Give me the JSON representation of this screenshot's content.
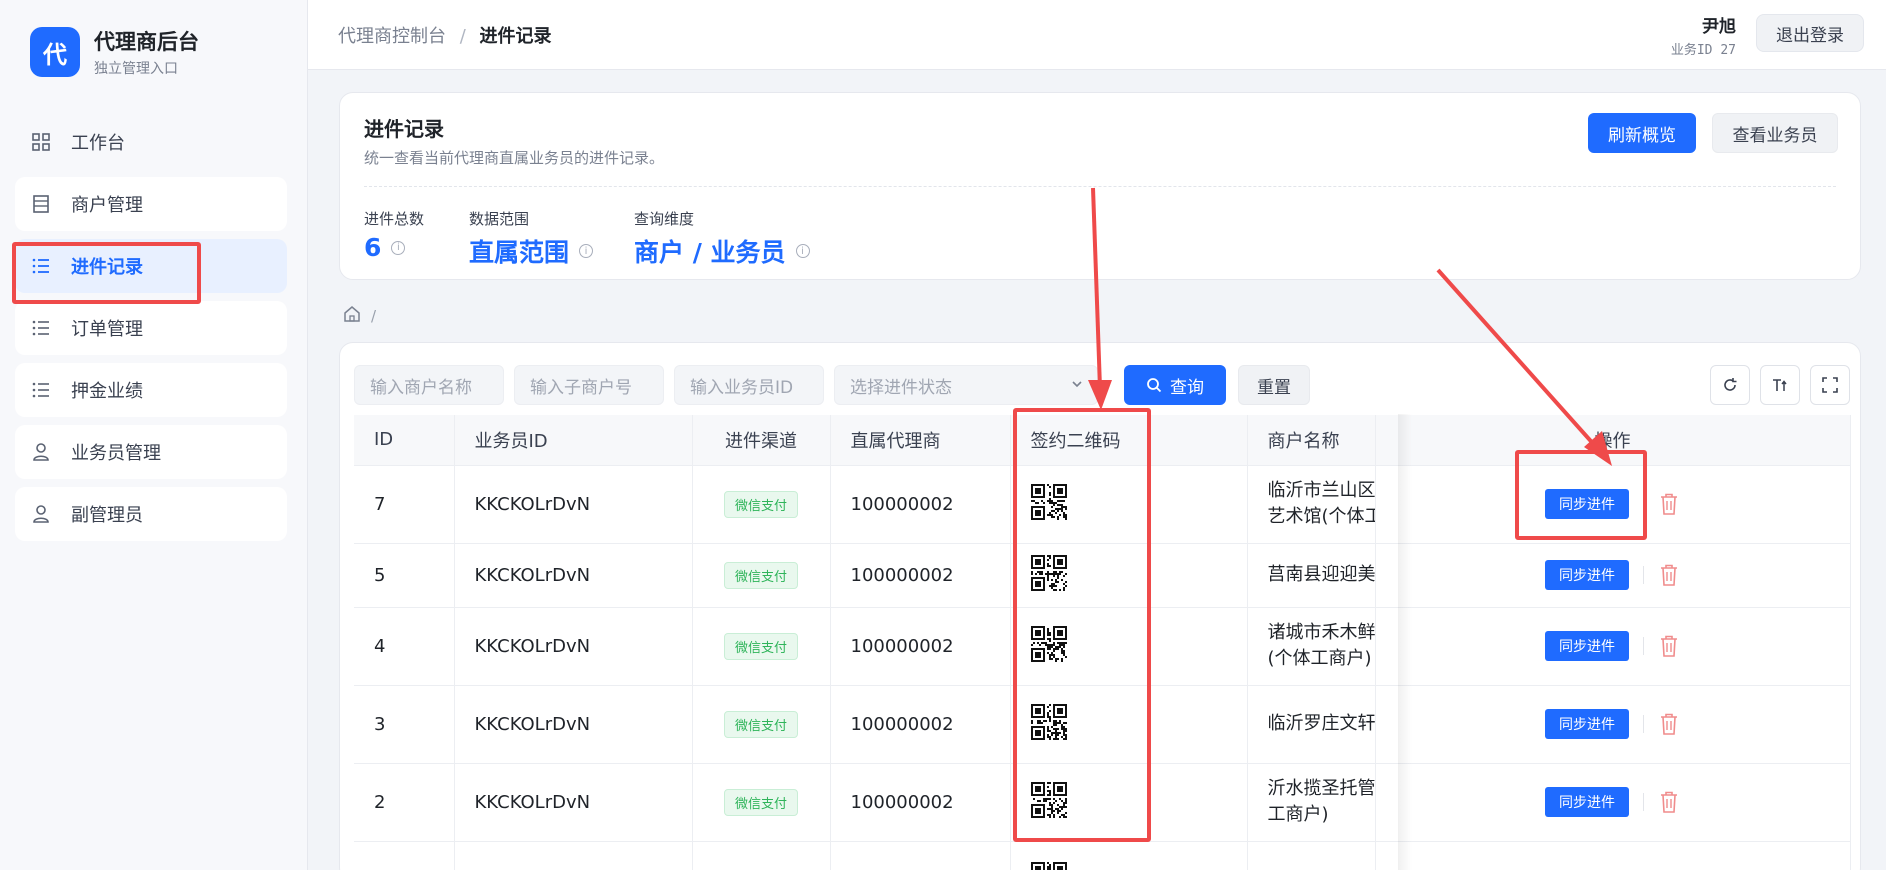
{
  "brand": {
    "logo_char": "代",
    "title": "代理商后台",
    "subtitle": "独立管理入口"
  },
  "menu": [
    {
      "label": "工作台",
      "icon": "grid-icon"
    },
    {
      "label": "商户管理",
      "icon": "store-icon"
    },
    {
      "label": "进件记录",
      "icon": "list-icon",
      "active": true
    },
    {
      "label": "订单管理",
      "icon": "list-icon"
    },
    {
      "label": "押金业绩",
      "icon": "list-icon"
    },
    {
      "label": "业务员管理",
      "icon": "user-icon"
    },
    {
      "label": "副管理员",
      "icon": "user-icon"
    }
  ],
  "topbar": {
    "breadcrumb_parent": "代理商控制台",
    "breadcrumb_sep": "/",
    "breadcrumb_current": "进件记录",
    "user_name": "尹旭",
    "user_id": "业务ID 27",
    "logout_label": "退出登录"
  },
  "header": {
    "title": "进件记录",
    "desc": "统一查看当前代理商直属业务员的进件记录。",
    "refresh_label": "刷新概览",
    "view_staff_label": "查看业务员",
    "stats": [
      {
        "label": "进件总数",
        "value": "6"
      },
      {
        "label": "数据范围",
        "value": "直属范围"
      },
      {
        "label": "查询维度",
        "value": "商户 / 业务员"
      }
    ]
  },
  "sub_breadcrumb": {
    "sep": "/"
  },
  "filters": {
    "merchant_name_placeholder": "输入商户名称",
    "sub_merchant_placeholder": "输入子商户号",
    "staff_id_placeholder": "输入业务员ID",
    "status_placeholder": "选择进件状态",
    "query_label": "查询",
    "reset_label": "重置"
  },
  "table": {
    "headers": [
      "ID",
      "业务员ID",
      "进件渠道",
      "直属代理商",
      "签约二维码",
      "商户名称",
      "操作"
    ],
    "rows": [
      {
        "id": "7",
        "staff_id": "KKCKOLrDvN",
        "channel": "微信支付",
        "agent": "100000002",
        "merchant_l1": "临沂市兰山区花",
        "merchant_l2": "艺术馆(个体工商"
      },
      {
        "id": "5",
        "staff_id": "KKCKOLrDvN",
        "channel": "微信支付",
        "agent": "100000002",
        "merchant_l1": "莒南县迎迎美妆",
        "merchant_l2": ""
      },
      {
        "id": "4",
        "staff_id": "KKCKOLrDvN",
        "channel": "微信支付",
        "agent": "100000002",
        "merchant_l1": "诸城市禾木鲜润",
        "merchant_l2": "(个体工商户)"
      },
      {
        "id": "3",
        "staff_id": "KKCKOLrDvN",
        "channel": "微信支付",
        "agent": "100000002",
        "merchant_l1": "临沂罗庄文轩书",
        "merchant_l2": ""
      },
      {
        "id": "2",
        "staff_id": "KKCKOLrDvN",
        "channel": "微信支付",
        "agent": "100000002",
        "merchant_l1": "沂水揽圣托管中",
        "merchant_l2": "工商户)"
      },
      {
        "id": "",
        "staff_id": "",
        "channel": "",
        "agent": "",
        "merchant_l1": "",
        "merchant_l2": ""
      }
    ],
    "sync_label": "同步进件"
  },
  "colors": {
    "accent": "#1f6bff",
    "annotation": "#ef4a4a",
    "tag_green": "#2fb45a",
    "danger": "#f08c8c"
  }
}
